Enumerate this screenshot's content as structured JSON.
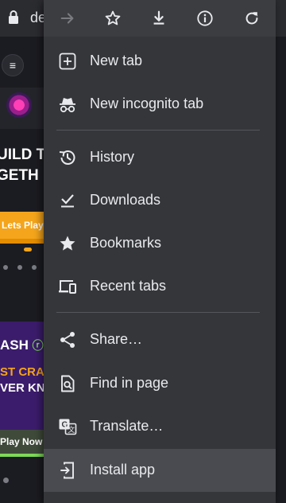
{
  "background": {
    "url_text": "de",
    "headline": [
      "UILD TI",
      "GETH"
    ],
    "cta_label": "Lets Play",
    "crash_label": "ASH",
    "crash_lines": [
      "ST CRAS",
      "VER KN"
    ],
    "play_now": "Play Now"
  },
  "menu": {
    "toolbar_icons": [
      "forward-icon",
      "star-icon",
      "download-icon",
      "info-icon",
      "refresh-icon"
    ],
    "items": [
      {
        "label": "New tab",
        "icon": "plus-box-icon"
      },
      {
        "label": "New incognito tab",
        "icon": "incognito-icon"
      },
      {
        "label": "History",
        "icon": "history-icon"
      },
      {
        "label": "Downloads",
        "icon": "downloads-icon"
      },
      {
        "label": "Bookmarks",
        "icon": "star-filled-icon"
      },
      {
        "label": "Recent tabs",
        "icon": "devices-icon"
      },
      {
        "label": "Share…",
        "icon": "share-icon"
      },
      {
        "label": "Find in page",
        "icon": "find-icon"
      },
      {
        "label": "Translate…",
        "icon": "translate-icon"
      },
      {
        "label": "Install app",
        "icon": "install-app-icon"
      }
    ]
  },
  "colors": {
    "menu_bg": "#35363a",
    "highlight": "#4a4b50",
    "text": "#e8eaed",
    "accent_orange": "#f4a51c",
    "accent_green": "#7ed957"
  }
}
